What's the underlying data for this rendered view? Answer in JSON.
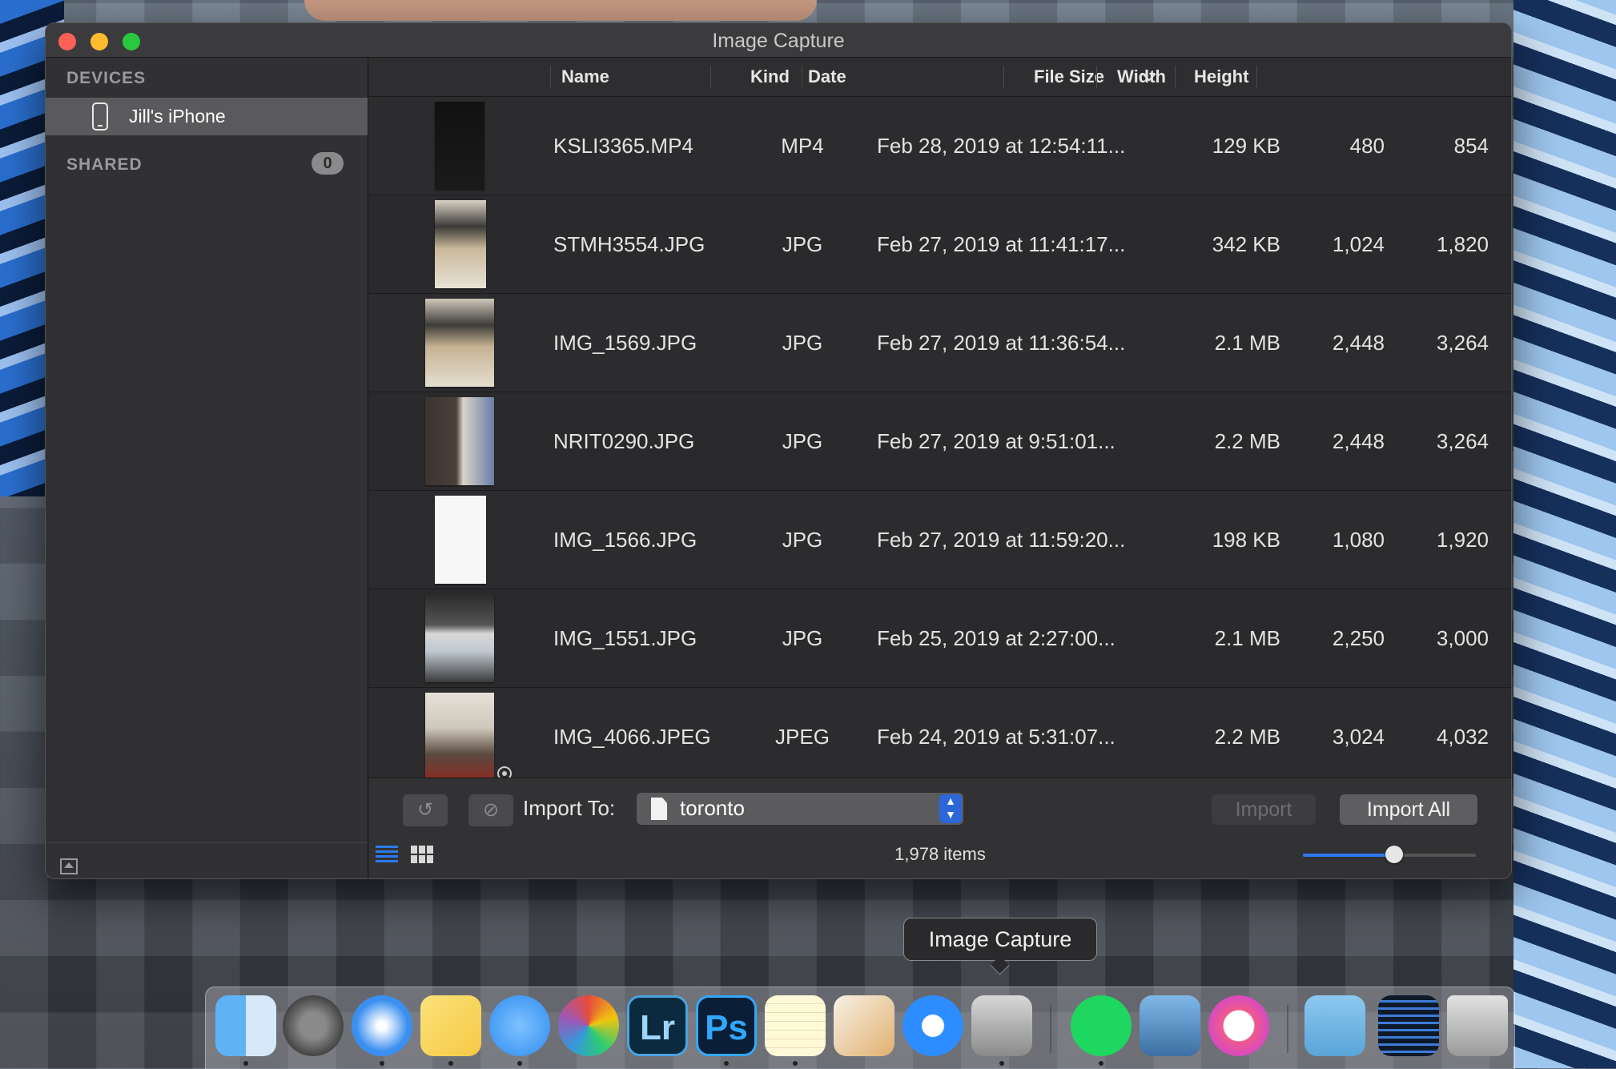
{
  "window": {
    "title": "Image Capture"
  },
  "sidebar": {
    "devices_heading": "DEVICES",
    "device_label": "Jill's iPhone",
    "shared_heading": "SHARED",
    "shared_count": "0"
  },
  "table": {
    "headers": {
      "name": "Name",
      "kind": "Kind",
      "date": "Date",
      "file_size": "File Size",
      "width": "Width",
      "height": "Height"
    },
    "sort_column": "Date",
    "rows": [
      {
        "name": "KSLI3365.MP4",
        "kind": "MP4",
        "date": "Feb 28, 2019 at 12:54:11...",
        "size": "129 KB",
        "width": "480",
        "height": "854"
      },
      {
        "name": "STMH3554.JPG",
        "kind": "JPG",
        "date": "Feb 27, 2019 at 11:41:17...",
        "size": "342 KB",
        "width": "1,024",
        "height": "1,820"
      },
      {
        "name": "IMG_1569.JPG",
        "kind": "JPG",
        "date": "Feb 27, 2019 at 11:36:54...",
        "size": "2.1 MB",
        "width": "2,448",
        "height": "3,264"
      },
      {
        "name": "NRIT0290.JPG",
        "kind": "JPG",
        "date": "Feb 27, 2019 at 9:51:01...",
        "size": "2.2 MB",
        "width": "2,448",
        "height": "3,264"
      },
      {
        "name": "IMG_1566.JPG",
        "kind": "JPG",
        "date": "Feb 27, 2019 at 11:59:20...",
        "size": "198 KB",
        "width": "1,080",
        "height": "1,920"
      },
      {
        "name": "IMG_1551.JPG",
        "kind": "JPG",
        "date": "Feb 25, 2019 at 2:27:00...",
        "size": "2.1 MB",
        "width": "2,250",
        "height": "3,000"
      },
      {
        "name": "IMG_4066.JPEG",
        "kind": "JPEG",
        "date": "Feb 24, 2019 at 5:31:07...",
        "size": "2.2 MB",
        "width": "3,024",
        "height": "4,032"
      }
    ]
  },
  "bottombar": {
    "import_to_label": "Import To:",
    "destination": "toronto",
    "import_label": "Import",
    "import_all_label": "Import All",
    "items_count": "1,978 items",
    "thumbnail_size_fraction": 0.53
  },
  "tooltip": {
    "text": "Image Capture"
  },
  "dock": {
    "apps": [
      "finder-icon",
      "system-preferences-icon",
      "safari-icon",
      "stickies-icon",
      "messages-icon",
      "aperture-icon",
      "lightroom-icon",
      "photoshop-icon",
      "notes-icon",
      "pages-icon",
      "zoom-icon",
      "image-capture-icon",
      "spotify-icon",
      "preview-icon",
      "itunes-icon",
      "downloads-folder-icon",
      "activity-icon",
      "trash-icon"
    ],
    "lightroom_text": "Lr",
    "photoshop_text": "Ps"
  },
  "colors": {
    "accent": "#2b7af0",
    "window_bg": "#2a2a2c",
    "sidebar_selected": "#5a5a5d"
  }
}
